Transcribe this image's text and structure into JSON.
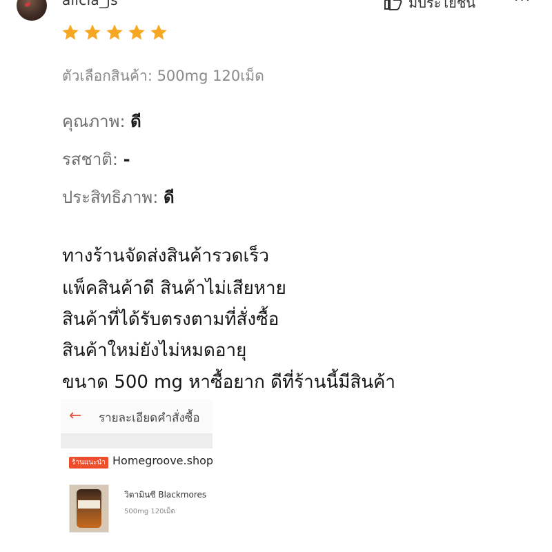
{
  "review": {
    "username": "alicia_js",
    "helpful_label": "มีประโยชน์",
    "more_label": "···",
    "rating": 5,
    "rating_max": 5,
    "star_color": "#f5a623",
    "variant": "ตัวเลือกสินค้า: 500mg 120เม็ด",
    "attributes": [
      {
        "label": "คุณภาพ:",
        "value": "ดี"
      },
      {
        "label": "รสชาติ:",
        "value": "-"
      },
      {
        "label": "ประสิทธิภาพ:",
        "value": "ดี"
      }
    ],
    "body_lines": [
      "ทางร้านจัดส่งสินค้ารวดเร็ว",
      "แพ็คสินค้าดี สินค้าไม่เสียหาย",
      "สินค้าที่ได้รับตรงตามที่สั่งซื้อ",
      "สินค้าใหม่ยังไม่หมดอายุ",
      "ขนาด 500 mg หาซื้อยาก ดีที่ร้านนี้มีสินค้า"
    ]
  },
  "attached_screenshot": {
    "back_icon": "arrow-left-icon",
    "title": "รายละเอียดคำสั่งซื้อ",
    "shop_badge": "ร้านแนะนำ",
    "shop_name": "Homegroove.shop",
    "product_name": "วิตามินซี Blackmores",
    "product_variant": "500mg 120เม็ด",
    "accent_color": "#ee4d2d"
  }
}
